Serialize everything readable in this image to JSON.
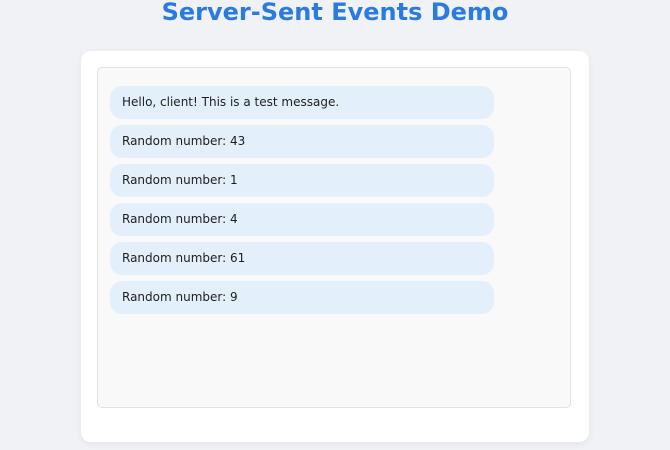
{
  "header": {
    "title": "Server-Sent Events Demo"
  },
  "messages": [
    {
      "text": "Hello, client! This is a test message."
    },
    {
      "text": "Random number: 43"
    },
    {
      "text": "Random number: 1"
    },
    {
      "text": "Random number: 4"
    },
    {
      "text": "Random number: 61"
    },
    {
      "text": "Random number: 9"
    }
  ],
  "colors": {
    "page_background": "#f0f2f5",
    "title": "#2a7ae2",
    "message_background": "#e3f0fc",
    "log_background": "#f9f9f9"
  }
}
